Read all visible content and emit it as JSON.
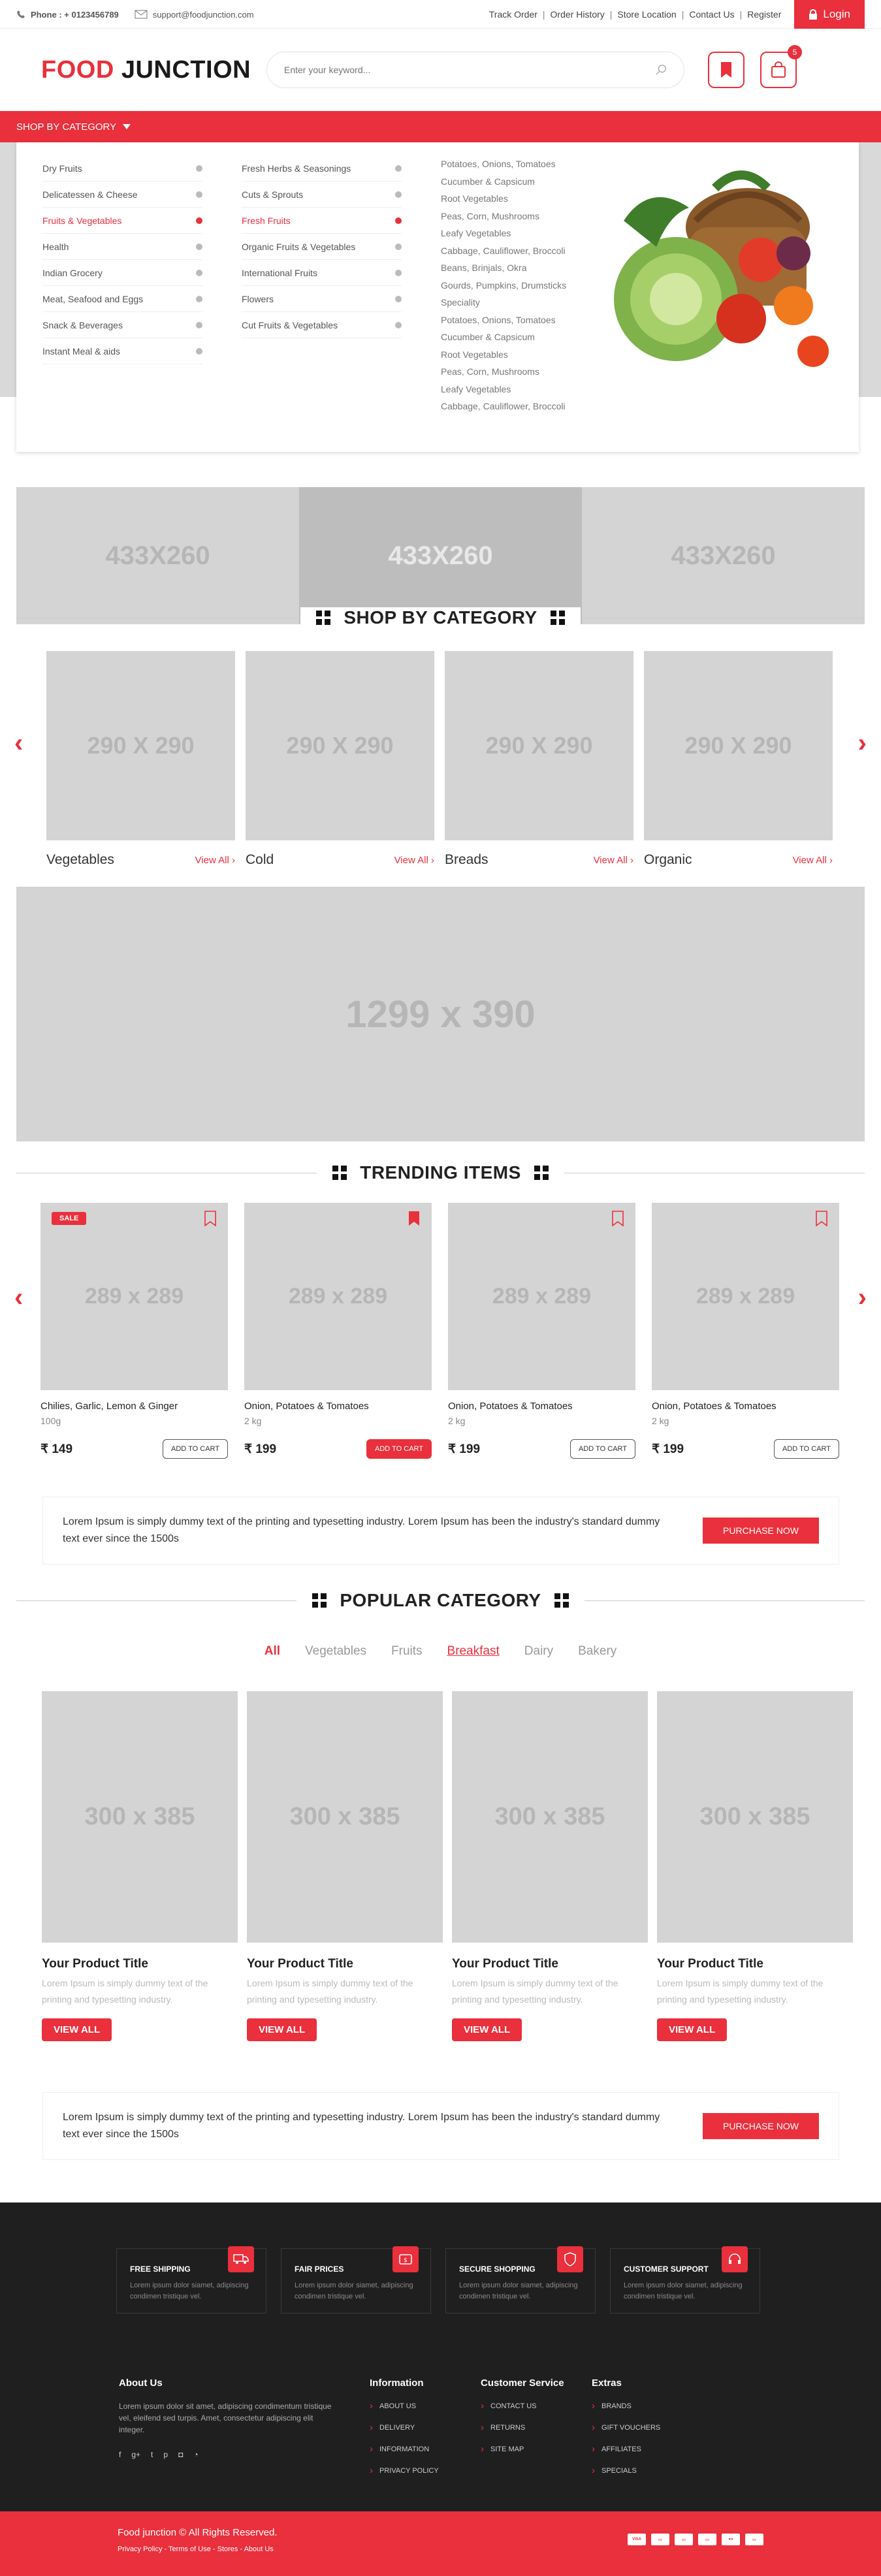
{
  "topbar": {
    "phone": "Phone : + 0123456789",
    "email": "support@foodjunction.com",
    "links": [
      "Track Order",
      "Order History",
      "Store Location",
      "Contact Us",
      "Register"
    ],
    "login": "Login"
  },
  "header": {
    "logo_part1": "FOOD",
    "logo_part2": "JUNCTION",
    "search_placeholder": "Enter your keyword...",
    "cart_count": "5"
  },
  "nav": {
    "category_label": "SHOP BY CATEGORY"
  },
  "mega_menu": {
    "col1": [
      "Dry Fruits",
      "Delicatessen & Cheese",
      "Fruits & Vegetables",
      "Health",
      "Indian Grocery",
      "Meat, Seafood and Eggs",
      "Snack & Beverages",
      "Instant Meal & aids"
    ],
    "col1_active": 2,
    "col2": [
      "Fresh Herbs & Seasonings",
      "Cuts & Sprouts",
      "Fresh Fruits",
      "Organic Fruits & Vegetables",
      "International Fruits",
      "Flowers",
      "Cut Fruits & Vegetables"
    ],
    "col2_active": 2,
    "col3": [
      "Potatoes, Onions, Tomatoes",
      "Cucumber & Capsicum",
      "Root Vegetables",
      "Peas, Corn, Mushrooms",
      "Leafy Vegetables",
      "Cabbage, Cauliflower, Broccoli",
      "Beans, Brinjals, Okra",
      "Gourds, Pumpkins, Drumsticks",
      "Speciality",
      "Potatoes, Onions, Tomatoes",
      "Cucumber & Capsicum",
      "Root Vegetables",
      "Peas, Corn, Mushrooms",
      "Leafy Vegetables",
      "Cabbage, Cauliflower, Broccoli"
    ]
  },
  "banners": [
    "433X260",
    "433X260",
    "433X260"
  ],
  "shop_by_category": {
    "title": "SHOP BY CATEGORY",
    "view_all": "View All ›",
    "items": [
      {
        "placeholder": "290 X 290",
        "name": "Vegetables"
      },
      {
        "placeholder": "290 X 290",
        "name": "Cold"
      },
      {
        "placeholder": "290 X 290",
        "name": "Breads"
      },
      {
        "placeholder": "290 X 290",
        "name": "Organic"
      }
    ]
  },
  "big_banner": "1299 x 390",
  "trending": {
    "title": "TRENDING ITEMS",
    "sale": "SALE",
    "add_to_cart": "ADD TO CART",
    "items": [
      {
        "placeholder": "289 x 289",
        "name": "Chilies, Garlic, Lemon & Ginger",
        "weight": "100g",
        "price": "₹ 149"
      },
      {
        "placeholder": "289 x 289",
        "name": "Onion, Potatoes & Tomatoes",
        "weight": "2 kg",
        "price": "₹ 199"
      },
      {
        "placeholder": "289 x 289",
        "name": "Onion, Potatoes & Tomatoes",
        "weight": "2 kg",
        "price": "₹ 199"
      },
      {
        "placeholder": "289 x 289",
        "name": "Onion, Potatoes & Tomatoes",
        "weight": "2 kg",
        "price": "₹ 199"
      }
    ]
  },
  "promo": {
    "text": "Lorem Ipsum is simply dummy text of the printing and typesetting industry. Lorem Ipsum has been the industry's standard dummy text ever since the 1500s",
    "button": "PURCHASE NOW"
  },
  "popular": {
    "title": "POPULAR CATEGORY",
    "tabs": [
      "All",
      "Vegetables",
      "Fruits",
      "Breakfast",
      "Dairy",
      "Bakery"
    ],
    "product_title": "Your Product Title",
    "product_desc": "Lorem Ipsum is simply dummy text of the printing and typesetting industry.",
    "button": "VIEW ALL",
    "placeholder": "300 x 385"
  },
  "footer": {
    "features": [
      {
        "title": "FREE SHIPPING",
        "desc": "Lorem ipsum dolor siamet, adipiscing condimen tristique vel."
      },
      {
        "title": "FAIR PRICES",
        "desc": "Lorem ipsum dolor siamet, adipiscing condimen tristique vel."
      },
      {
        "title": "SECURE SHOPPING",
        "desc": "Lorem ipsum dolor siamet, adipiscing condimen tristique vel."
      },
      {
        "title": "CUSTOMER SUPPORT",
        "desc": "Lorem ipsum dolor siamet, adipiscing condimen tristique vel."
      }
    ],
    "about_title": "About Us",
    "about_text": "Lorem ipsum dolor sit amet, adipiscing condimentum tristique vel, eleifend sed turpis. Amet, consectetur adipiscing elit integer.",
    "information_title": "Information",
    "information": [
      "ABOUT US",
      "DELIVERY",
      "INFORMATION",
      "PRIVACY POLICY"
    ],
    "service_title": "Customer Service",
    "service": [
      "CONTACT US",
      "RETURNS",
      "SITE MAP"
    ],
    "extras_title": "Extras",
    "extras": [
      "BRANDS",
      "GIFT VOUCHERS",
      "AFFILIATES",
      "SPECIALS"
    ],
    "copyright": "Food junction © All Rights Reserved.",
    "bottom_links": "Privacy Policy - Terms of Use - Stores - About Us"
  }
}
